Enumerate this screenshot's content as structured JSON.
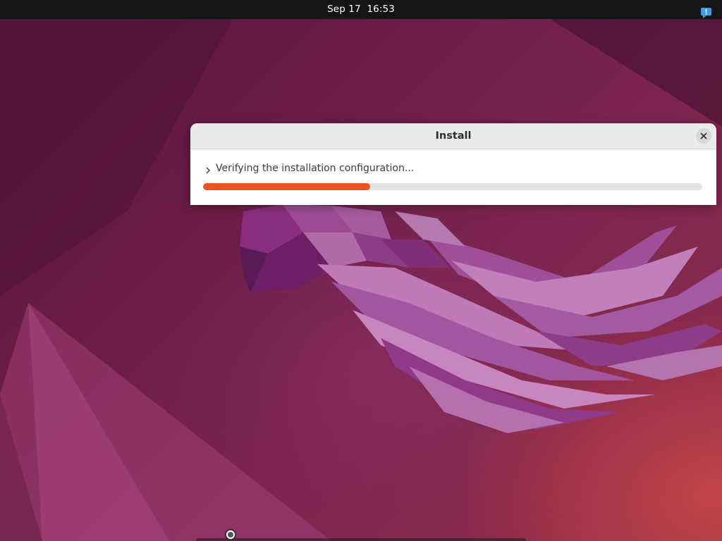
{
  "top_bar": {
    "clock": "Sep 17  16:53",
    "notification_icon": "notification-bubble-icon"
  },
  "install_window": {
    "title": "Install",
    "close_icon": "close-icon",
    "expander_icon": "chevron-right-icon",
    "status_text": "Verifying the installation configuration...",
    "progress": 0.335
  },
  "colors": {
    "accent": "#e95420",
    "top_bar": "#151515",
    "notification": "#3aa0e6"
  }
}
